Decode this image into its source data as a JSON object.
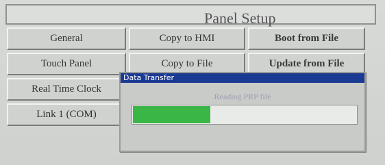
{
  "panel": {
    "title": "Panel Setup"
  },
  "buttons": {
    "general": "General",
    "touch_panel": "Touch Panel",
    "real_time_clock": "Real Time Clock",
    "link1": "Link 1 (COM)",
    "copy_to_hmi": "Copy to HMI",
    "copy_to_file": "Copy to File",
    "boot_from_file": "Boot from File",
    "update_from_file": "Update from File"
  },
  "dialog": {
    "title": "Data Transfer",
    "message": "Reading PRP file",
    "progress": 0.35
  },
  "colors": {
    "dialog_titlebar": "#1b3a92",
    "progress_fill": "#3ab646"
  }
}
